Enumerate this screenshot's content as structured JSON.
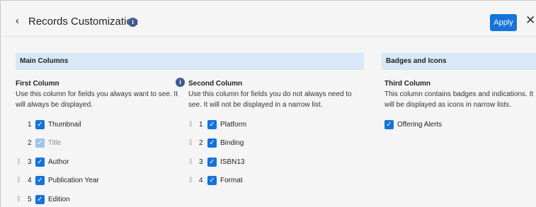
{
  "header": {
    "back_glyph": "‹",
    "title": "Records Customization",
    "info_glyph": "i",
    "apply_label": "Apply",
    "close_glyph": "✕"
  },
  "sections": {
    "main": "Main Columns",
    "badges": "Badges and Icons"
  },
  "first_column": {
    "title": "First Column",
    "description": "Use this column for fields you always want to see. It will always be displayed.",
    "items": [
      {
        "num": "1",
        "label": "Thumbnail",
        "checked": true,
        "disabled": false,
        "draggable": false
      },
      {
        "num": "2",
        "label": "Title",
        "checked": true,
        "disabled": true,
        "draggable": false
      },
      {
        "num": "3",
        "label": "Author",
        "checked": true,
        "disabled": false,
        "draggable": true
      },
      {
        "num": "4",
        "label": "Publication Year",
        "checked": true,
        "disabled": false,
        "draggable": true
      },
      {
        "num": "5",
        "label": "Edition",
        "checked": true,
        "disabled": false,
        "draggable": true
      }
    ]
  },
  "second_column": {
    "title": "Second Column",
    "description": "Use this column for fields you do not always need to see. It will not be displayed in a narrow list.",
    "items": [
      {
        "num": "1",
        "label": "Platform",
        "checked": true,
        "draggable": true
      },
      {
        "num": "2",
        "label": "Binding",
        "checked": true,
        "draggable": true
      },
      {
        "num": "3",
        "label": "ISBN13",
        "checked": true,
        "draggable": true
      },
      {
        "num": "4",
        "label": "Format",
        "checked": true,
        "draggable": true
      }
    ]
  },
  "third_column": {
    "title": "Third Column",
    "description": "This column contains badges and indications. It will be displayed as icons in narrow lists.",
    "items": [
      {
        "label": "Offering Alerts",
        "checked": true
      }
    ]
  },
  "icons": {
    "drag_handle": "drag-handle-icon",
    "check": "check-icon",
    "info": "info-icon"
  },
  "colors": {
    "accent": "#1573d9",
    "section_bg": "#d8e8f6",
    "info": "#3b5a91"
  }
}
